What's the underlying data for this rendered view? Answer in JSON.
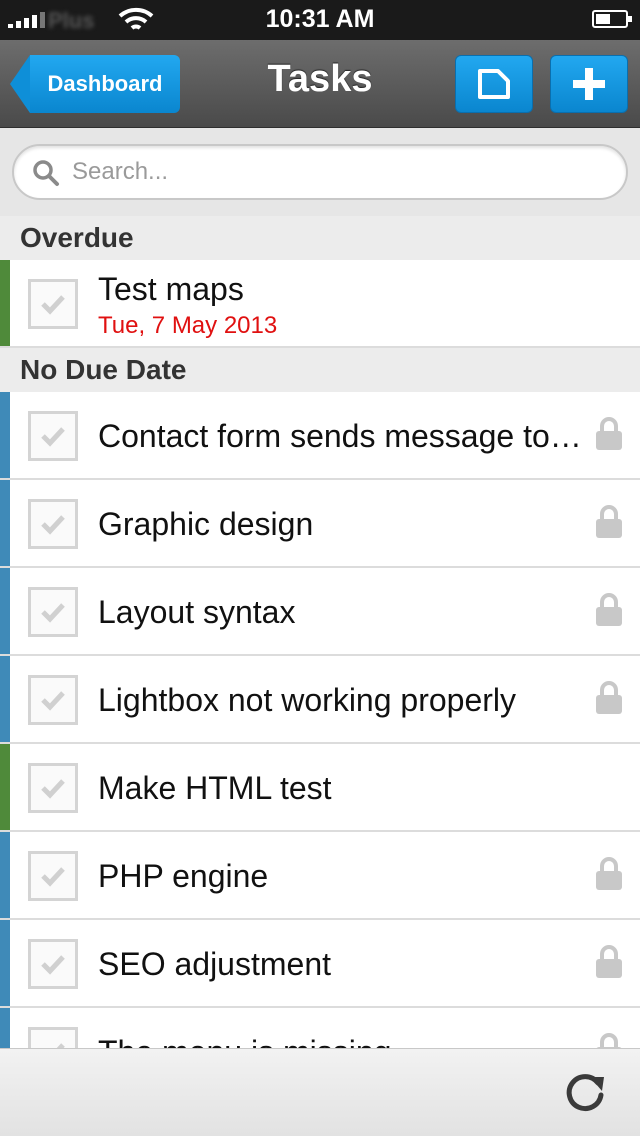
{
  "status_bar": {
    "carrier": "Plus",
    "time": "10:31 AM"
  },
  "nav": {
    "back_label": "Dashboard",
    "title": "Tasks",
    "folder_icon": "folder-icon",
    "add_icon": "plus-icon"
  },
  "search": {
    "placeholder": "Search..."
  },
  "sections": {
    "overdue": "Overdue",
    "no_due_date": "No Due Date"
  },
  "overdue_tasks": [
    {
      "title": "Test maps",
      "date": "Tue, 7 May 2013",
      "color": "#4f8a3a"
    }
  ],
  "tasks": [
    {
      "title": "Contact form sends message to the wrong email",
      "locked": true,
      "color": "#3f8ab8"
    },
    {
      "title": "Graphic design",
      "locked": true,
      "color": "#3f8ab8"
    },
    {
      "title": "Layout syntax",
      "locked": true,
      "color": "#3f8ab8"
    },
    {
      "title": "Lightbox not working properly",
      "locked": true,
      "color": "#3f8ab8"
    },
    {
      "title": "Make HTML test",
      "locked": false,
      "color": "#4f8a3a"
    },
    {
      "title": "PHP engine",
      "locked": true,
      "color": "#3f8ab8"
    },
    {
      "title": "SEO adjustment",
      "locked": true,
      "color": "#3f8ab8"
    },
    {
      "title": "The menu is missing",
      "locked": true,
      "color": "#3f8ab8"
    }
  ],
  "toolbar": {
    "refresh_icon": "refresh-icon"
  },
  "colors": {
    "accent": "#0a86cf",
    "overdue_date": "#e01010",
    "lock": "#c8c8c8"
  }
}
